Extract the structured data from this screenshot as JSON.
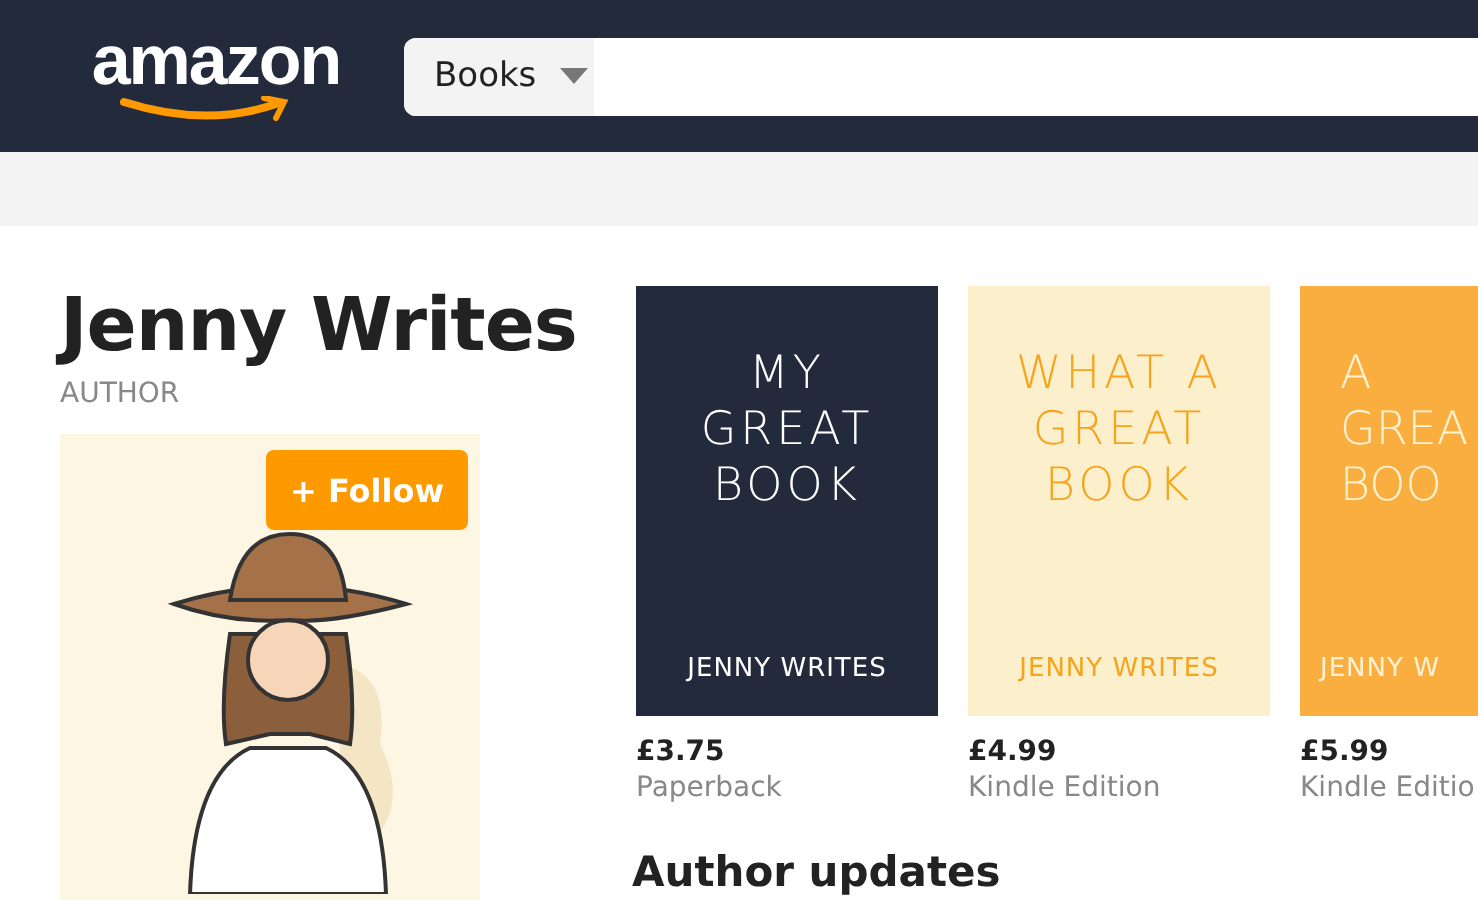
{
  "header": {
    "logo": "amazon",
    "search": {
      "category": "Books"
    }
  },
  "author": {
    "name": "Jenny Writes",
    "role": "AUTHOR",
    "follow_button": "+ Follow"
  },
  "books": [
    {
      "kind": "dark",
      "title_lines": [
        "MY",
        "GREAT",
        "BOOK"
      ],
      "author": "JENNY WRITES",
      "price": "£3.75",
      "format": "Paperback"
    },
    {
      "kind": "light",
      "title_lines": [
        "WHAT A",
        "GREAT",
        "BOOK"
      ],
      "author": "JENNY WRITES",
      "price": "£4.99",
      "format": "Kindle Edition"
    },
    {
      "kind": "orange",
      "title_lines": [
        "A",
        "GREA",
        "BOO"
      ],
      "author": "JENNY W",
      "price": "£5.99",
      "format": "Kindle Editio"
    }
  ],
  "updates_heading": "Author updates"
}
